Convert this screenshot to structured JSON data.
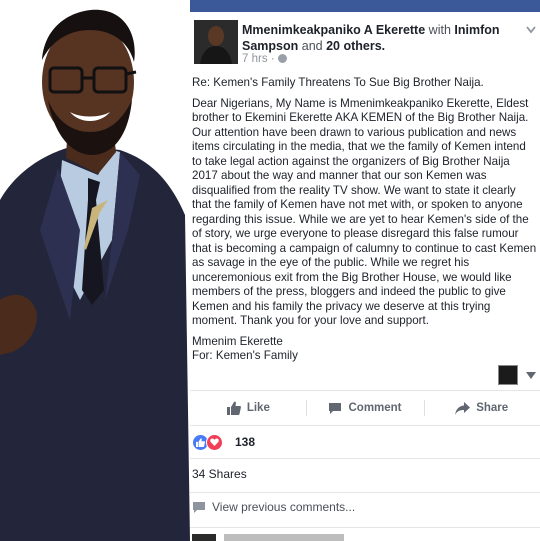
{
  "photo": {
    "alt_icon": "man-portrait"
  },
  "post": {
    "author": "Mmenimkeakpaniko A Ekerette",
    "with_word": "with",
    "tagged": "Inimfon Sampson",
    "and_word": "and",
    "others": "20 others.",
    "time": "7 hrs ·",
    "subject": "Re: Kemen's Family Threatens To Sue Big Brother Naija.",
    "body": "Dear Nigerians, My Name is Mmenimkeakpaniko Ekerette, Eldest brother to Ekemini Ekerette AKA KEMEN of the Big Brother Naija. Our attention have been drawn to various publication and news items circulating in the media, that we the family of Kemen intend to take legal action against the organizers of Big Brother Naija 2017 about the way and manner that our son Kemen was disqualified from the reality TV show. We want to state it clearly that the family of Kemen have not met with, or spoken to anyone regarding this issue. While we are yet to hear Kemen's side of the of story, we urge everyone to please disregard this false rumour that is becoming a campaign of calumny to continue to cast Kemen as savage in the eye of the public. While we regret his unceremonious exit from the Big Brother House, we would like members of the press, bloggers and indeed the public to give Kemen and his family the privacy we deserve at this trying moment. Thank you for your love and support.",
    "signature_name": "Mmenim Ekerette",
    "signature_for": "For: Kemen's Family"
  },
  "actions": {
    "like": "Like",
    "comment": "Comment",
    "share": "Share"
  },
  "stats": {
    "reaction_count": "138",
    "shares": "34 Shares",
    "view_previous": "View previous comments..."
  },
  "colors": {
    "facebook_blue": "#3b5998",
    "like_blue": "#4a7bf7",
    "love_red": "#f33e58",
    "text": "#1d2129",
    "muted": "#606770"
  }
}
